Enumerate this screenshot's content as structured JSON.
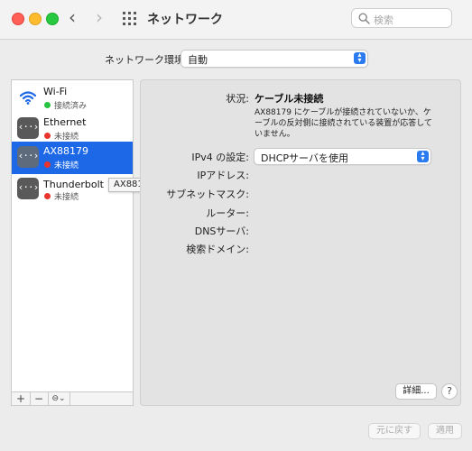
{
  "window": {
    "title": "ネットワーク"
  },
  "search": {
    "placeholder": "検索"
  },
  "location": {
    "label": "ネットワーク環境:",
    "value": "自動"
  },
  "services": [
    {
      "name": "Wi-Fi",
      "status": "接続済み",
      "status_color": "#27c341",
      "icon": "wifi-icon"
    },
    {
      "name": "Ethernet",
      "status": "未接続",
      "status_color": "#e8342c",
      "icon": "ethernet-icon"
    },
    {
      "name": "AX88179",
      "status": "未接続",
      "status_color": "#e8342c",
      "icon": "ethernet-icon",
      "selected": true
    },
    {
      "name": "Thunderbolt ブリッジ",
      "status": "未接続",
      "status_color": "#e8342c",
      "icon": "ethernet-icon"
    }
  ],
  "tooltip": "AX88179",
  "toolbar": {
    "add": "+",
    "remove": "−",
    "action": "⊖⌄"
  },
  "detail": {
    "status_label": "状況:",
    "status_value": "ケーブル未接続",
    "status_desc": "AX88179 にケーブルが接続されていないか、ケーブルの反対側に接続されている装置が応答していません。",
    "ipv4_label": "IPv4 の設定:",
    "ipv4_value": "DHCPサーバを使用",
    "ip_label": "IPアドレス:",
    "subnet_label": "サブネットマスク:",
    "router_label": "ルーター:",
    "dns_label": "DNSサーバ:",
    "search_domain_label": "検索ドメイン:",
    "advanced_button": "詳細...",
    "help_button": "?"
  },
  "footer": {
    "revert": "元に戻す",
    "apply": "適用"
  },
  "colors": {
    "accent": "#1c68e6",
    "connected": "#27c341",
    "disconnected": "#e8342c"
  }
}
